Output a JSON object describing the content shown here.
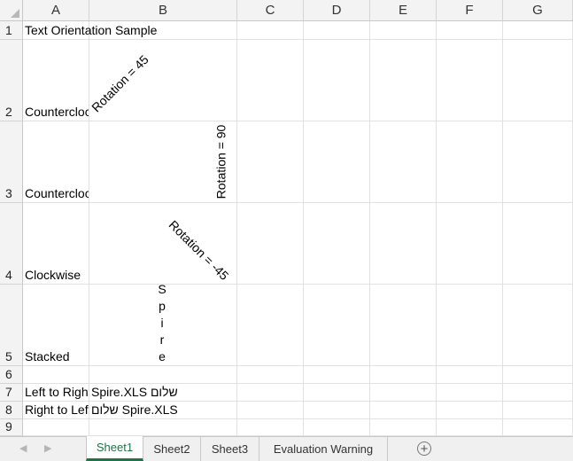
{
  "columns": [
    "A",
    "B",
    "C",
    "D",
    "E",
    "F",
    "G"
  ],
  "rows": [
    "1",
    "2",
    "3",
    "4",
    "5",
    "6",
    "7",
    "8",
    "9"
  ],
  "cells": {
    "A1": "Text Orientation Sample",
    "A2": "Counterclockwise",
    "A3": "Counterclockwise",
    "A4": "Clockwise",
    "A5": "Stacked",
    "A7": "Left to Right",
    "A8": "Right to Left",
    "B2": "Rotation = 45",
    "B3": "Rotation = 90",
    "B4": "Rotation = -45",
    "B5": [
      "S",
      "p",
      "i",
      "r",
      "e"
    ],
    "B7": "Spire.XLS שלום",
    "B8": "שלום Spire.XLS"
  },
  "sheet_tabs": [
    {
      "label": "Sheet1",
      "active": true
    },
    {
      "label": "Sheet2",
      "active": false
    },
    {
      "label": "Sheet3",
      "active": false
    },
    {
      "label": "Evaluation Warning",
      "active": false
    }
  ],
  "icons": {
    "scroll_left": "triangle-left-icon",
    "scroll_right": "triangle-right-icon",
    "add_sheet": "plus-circle-icon"
  },
  "colors": {
    "active_tab": "#217346",
    "header_bg": "#f3f3f3",
    "gridline": "#e1e1e1"
  }
}
